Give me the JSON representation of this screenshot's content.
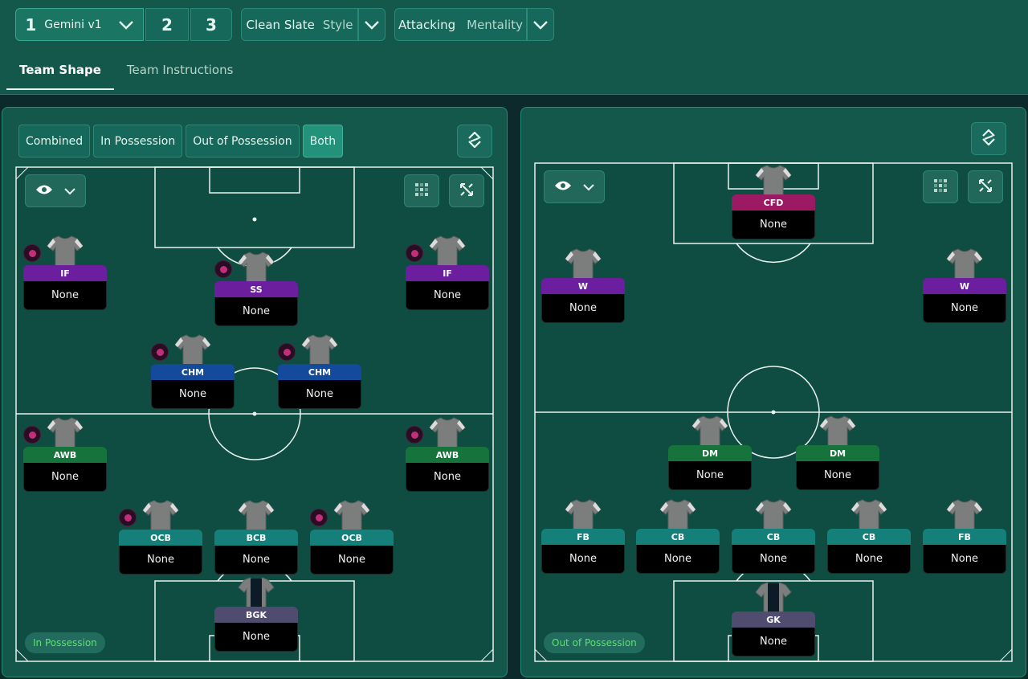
{
  "tactics": [
    {
      "number": "1",
      "name": "Gemini v1"
    },
    {
      "number": "2"
    },
    {
      "number": "3"
    }
  ],
  "style": {
    "value": "Clean Slate",
    "label": "Style"
  },
  "mentality": {
    "value": "Attacking",
    "label": "Mentality"
  },
  "tabs": [
    "Team Shape",
    "Team Instructions"
  ],
  "view_toggle": [
    "Combined",
    "In Possession",
    "Out of Possession",
    "Both"
  ],
  "left_pitch": {
    "mode_label": "In Possession",
    "players": [
      {
        "role": "IF",
        "player": "None",
        "color": "#6b1f9e"
      },
      {
        "role": "SS",
        "player": "None",
        "color": "#6b1f9e"
      },
      {
        "role": "IF",
        "player": "None",
        "color": "#6b1f9e"
      },
      {
        "role": "CHM",
        "player": "None",
        "color": "#134a9b"
      },
      {
        "role": "CHM",
        "player": "None",
        "color": "#134a9b"
      },
      {
        "role": "AWB",
        "player": "None",
        "color": "#15733b"
      },
      {
        "role": "AWB",
        "player": "None",
        "color": "#15733b"
      },
      {
        "role": "OCB",
        "player": "None",
        "color": "#15807a"
      },
      {
        "role": "BCB",
        "player": "None",
        "color": "#15807a"
      },
      {
        "role": "OCB",
        "player": "None",
        "color": "#15807a"
      },
      {
        "role": "BGK",
        "player": "None",
        "color": "#4f4c70"
      }
    ]
  },
  "right_pitch": {
    "mode_label": "Out of Possession",
    "players": [
      {
        "role": "CFD",
        "player": "None",
        "color": "#9b1a63"
      },
      {
        "role": "W",
        "player": "None",
        "color": "#6b1f9e"
      },
      {
        "role": "W",
        "player": "None",
        "color": "#6b1f9e"
      },
      {
        "role": "DM",
        "player": "None",
        "color": "#15733b"
      },
      {
        "role": "DM",
        "player": "None",
        "color": "#15733b"
      },
      {
        "role": "FB",
        "player": "None",
        "color": "#15807a"
      },
      {
        "role": "CB",
        "player": "None",
        "color": "#15807a"
      },
      {
        "role": "CB",
        "player": "None",
        "color": "#15807a"
      },
      {
        "role": "CB",
        "player": "None",
        "color": "#15807a"
      },
      {
        "role": "FB",
        "player": "None",
        "color": "#15807a"
      },
      {
        "role": "GK",
        "player": "None",
        "color": "#4f4c70"
      }
    ]
  },
  "icons": [
    "chevron-down-icon",
    "eye-icon",
    "grid-icon",
    "expand-icon",
    "swap-icon",
    "shirt-icon",
    "player-badge-icon"
  ]
}
